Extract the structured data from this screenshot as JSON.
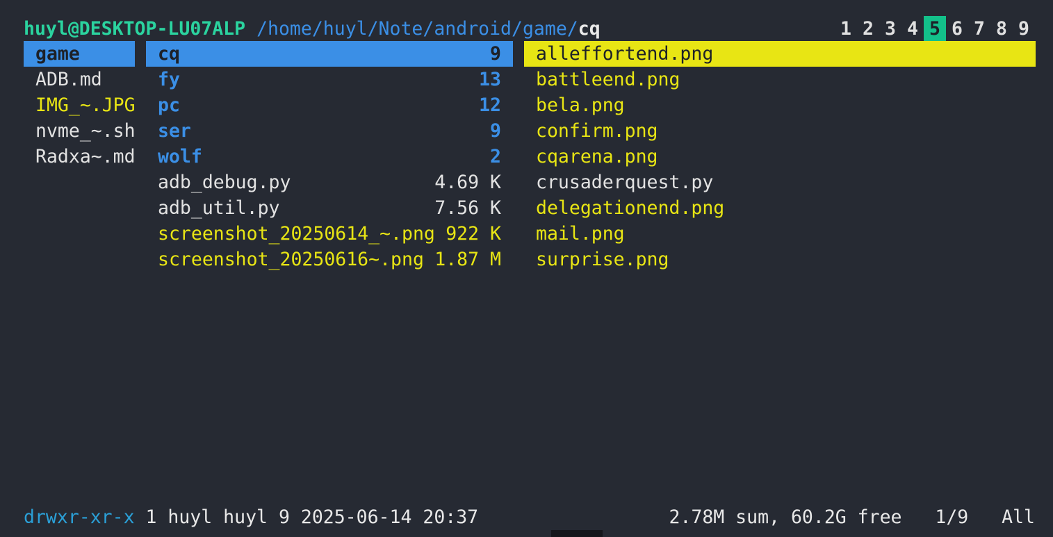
{
  "titlebar": {
    "host": "huyl@DESKTOP-LU07ALP",
    "path": "/home/huyl/Note/android/game/",
    "cwd": "cq",
    "tabs": [
      "1",
      "2",
      "3",
      "4",
      "5",
      "6",
      "7",
      "8",
      "9"
    ],
    "active_tab": "5"
  },
  "parent": {
    "items": [
      {
        "name": "game",
        "type": "dir",
        "selected": true
      },
      {
        "name": "ADB.md",
        "type": "file"
      },
      {
        "name": "IMG_~.JPG",
        "type": "img"
      },
      {
        "name": "nvme_~.sh",
        "type": "file"
      },
      {
        "name": "Radxa~.md",
        "type": "file"
      }
    ]
  },
  "current": {
    "items": [
      {
        "name": "cq",
        "size": "9",
        "type": "dir",
        "selected": true
      },
      {
        "name": "fy",
        "size": "13",
        "type": "dir"
      },
      {
        "name": "pc",
        "size": "12",
        "type": "dir"
      },
      {
        "name": "ser",
        "size": "9",
        "type": "dir"
      },
      {
        "name": "wolf",
        "size": "2",
        "type": "dir"
      },
      {
        "name": "adb_debug.py",
        "size": "4.69 K",
        "type": "file"
      },
      {
        "name": "adb_util.py",
        "size": "7.56 K",
        "type": "file"
      },
      {
        "name": "screenshot_20250614_~.png",
        "size": "922 K",
        "type": "img"
      },
      {
        "name": "screenshot_20250616~.png",
        "size": "1.87 M",
        "type": "img"
      }
    ]
  },
  "preview": {
    "items": [
      {
        "name": "alleffortend.png",
        "type": "img",
        "selected": true
      },
      {
        "name": "battleend.png",
        "type": "img"
      },
      {
        "name": "bela.png",
        "type": "img"
      },
      {
        "name": "confirm.png",
        "type": "img"
      },
      {
        "name": "cqarena.png",
        "type": "img"
      },
      {
        "name": "crusaderquest.py",
        "type": "file"
      },
      {
        "name": "delegationend.png",
        "type": "img"
      },
      {
        "name": "mail.png",
        "type": "img"
      },
      {
        "name": "surprise.png",
        "type": "img"
      }
    ]
  },
  "statusbar": {
    "permissions": "drwxr-xr-x",
    "info": " 1 huyl huyl 9 2025-06-14 20:37",
    "summary": "2.78M sum, 60.2G free",
    "position": "1/9",
    "scroll": "All"
  },
  "colors": {
    "background": "#262a33",
    "directory": "#3b8fe6",
    "image": "#e8e514",
    "host": "#2bd39f",
    "active_tab": "#13c08a"
  }
}
